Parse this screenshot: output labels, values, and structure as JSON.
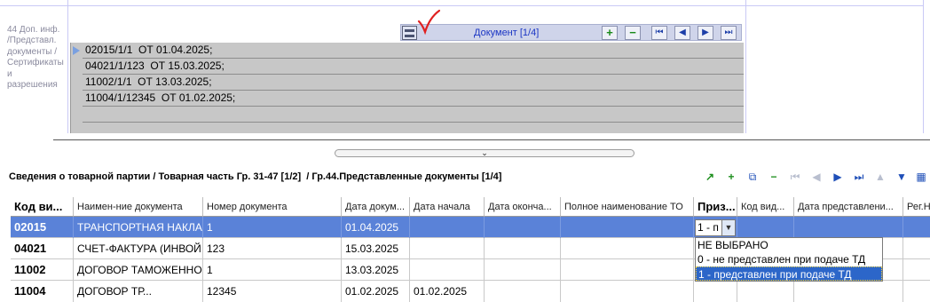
{
  "upper_form": {
    "row_label": "44 Доп. инф.\n/Представл.\nдокументы /\nСертификаты\nи\nразрешения",
    "doc_toolbar": {
      "title": "Документ [1/4]",
      "buttons": [
        "add-icon",
        "remove-icon",
        "first-icon",
        "prev-icon",
        "next-icon",
        "last-icon"
      ]
    },
    "docs": [
      "02015/1/1  ОТ 01.04.2025;",
      "04021/1/123  ОТ 15.03.2025;",
      "11002/1/1  ОТ 13.03.2025;",
      "11004/1/12345  ОТ 01.02.2025;",
      "",
      ""
    ]
  },
  "splitter": {
    "handle_glyph": "⌄"
  },
  "lower_panel": {
    "breadcrumb": "Сведения о товарной партии / Товарная часть Гр. 31-47 [1/2]  / Гр.44.Представленные документы [1/4]",
    "toolbar_icons": [
      "export-icon",
      "add-icon",
      "copy-icon",
      "remove-icon",
      "first-icon",
      "prev-icon",
      "next-icon",
      "last-icon",
      "up-icon",
      "down-icon",
      "columns-icon"
    ]
  },
  "grid": {
    "columns": [
      "Код ви...",
      "Наимен-ние документа",
      "Номер документа",
      "Дата докум...",
      "Дата начала",
      "Дата оконча...",
      "Полное наименование ТО",
      "Приз...",
      "Код вид...",
      "Дата представлени...",
      "Рег.Н"
    ],
    "rows": [
      [
        "02015",
        "ТРАНСПОРТНАЯ НАКЛА",
        "1",
        "01.04.2025",
        "",
        "",
        "",
        "",
        "",
        "",
        ""
      ],
      [
        "04021",
        "СЧЕТ-ФАКТУРА (ИНВОЙ",
        "123",
        "15.03.2025",
        "",
        "",
        "",
        "",
        "",
        "",
        ""
      ],
      [
        "11002",
        "ДОГОВОР ТАМОЖЕННО",
        "1",
        "13.03.2025",
        "",
        "",
        "",
        "",
        "",
        "",
        ""
      ],
      [
        "11004",
        "ДОГОВОР ТР...",
        "12345",
        "01.02.2025",
        "01.02.2025",
        "",
        "",
        "",
        "",
        "",
        ""
      ]
    ],
    "selected_row": 0,
    "combo_value": "1 - п",
    "dropdown_options": [
      "НЕ ВЫБРАНО",
      "0 - не представлен при подаче ТД",
      "1 - представлен при подаче ТД"
    ],
    "dropdown_selected": 2
  },
  "colors": {
    "selection": "#5a82d8",
    "toolbar_title": "#1a35c4",
    "grid_fill": "#c7c7c7",
    "annotation_check": "#e02020"
  }
}
